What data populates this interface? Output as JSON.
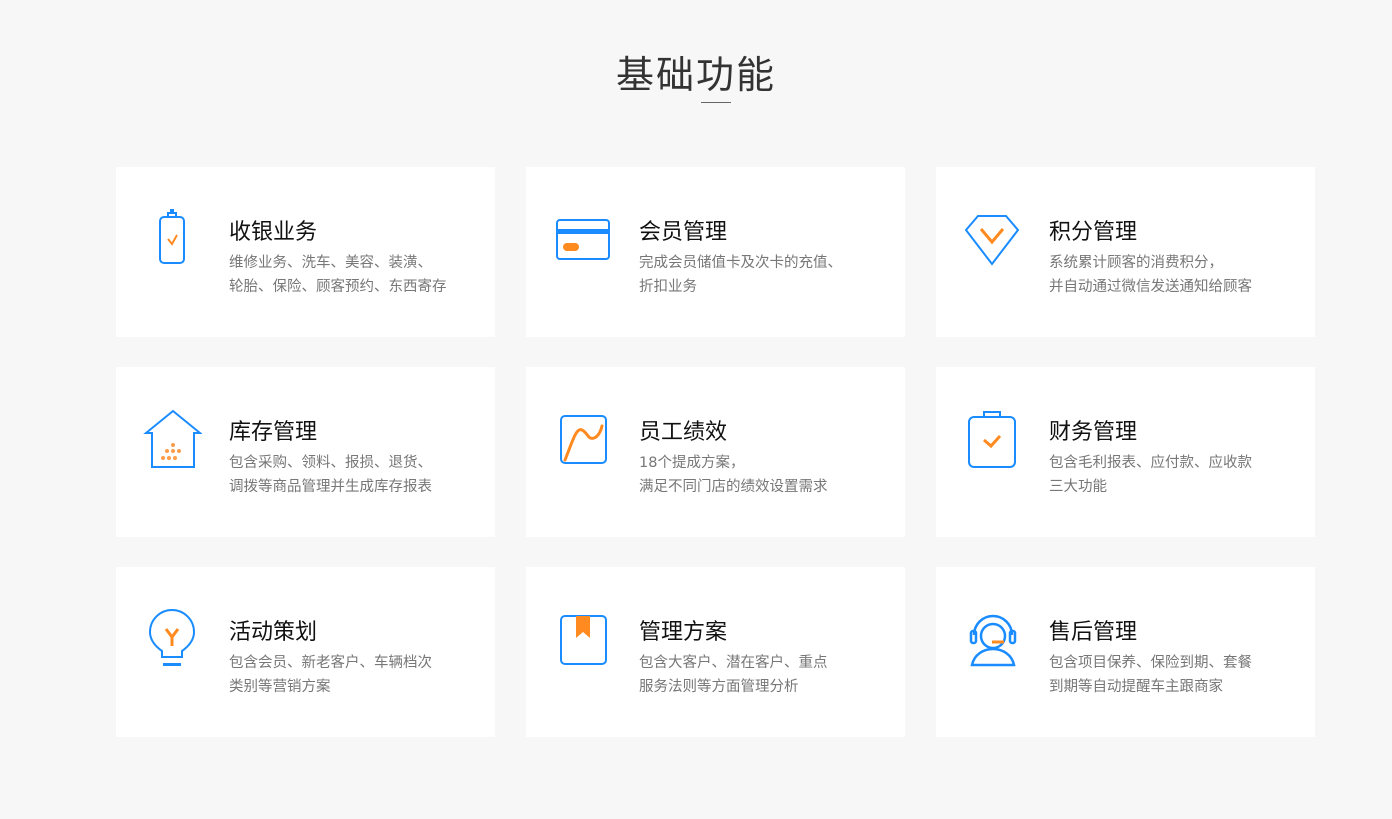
{
  "section_title": "基础功能",
  "colors": {
    "blue": "#1a8cff",
    "orange": "#ff8a1f"
  },
  "features": [
    {
      "icon": "phone-check-icon",
      "title": "收银业务",
      "desc": [
        "维修业务、洗车、美容、装潢、",
        "轮胎、保险、顾客预约、东西寄存"
      ]
    },
    {
      "icon": "card-icon",
      "title": "会员管理",
      "desc": [
        "完成会员储值卡及次卡的充值、",
        "折扣业务"
      ]
    },
    {
      "icon": "diamond-icon",
      "title": "积分管理",
      "desc": [
        "系统累计顾客的消费积分，",
        "并自动通过微信发送通知给顾客"
      ]
    },
    {
      "icon": "warehouse-icon",
      "title": "库存管理",
      "desc": [
        "包含采购、领料、报损、退货、",
        "调拨等商品管理并生成库存报表"
      ]
    },
    {
      "icon": "chart-icon",
      "title": "员工绩效",
      "desc": [
        "18个提成方案，",
        "满足不同门店的绩效设置需求"
      ]
    },
    {
      "icon": "clipboard-check-icon",
      "title": "财务管理",
      "desc": [
        "包含毛利报表、应付款、应收款",
        "三大功能"
      ]
    },
    {
      "icon": "bulb-icon",
      "title": "活动策划",
      "desc": [
        "包含会员、新老客户、车辆档次",
        "类别等营销方案"
      ]
    },
    {
      "icon": "bookmark-icon",
      "title": "管理方案",
      "desc": [
        "包含大客户、潜在客户、重点",
        "服务法则等方面管理分析"
      ]
    },
    {
      "icon": "headset-icon",
      "title": "售后管理",
      "desc": [
        "包含项目保养、保险到期、套餐",
        "到期等自动提醒车主跟商家"
      ]
    }
  ]
}
